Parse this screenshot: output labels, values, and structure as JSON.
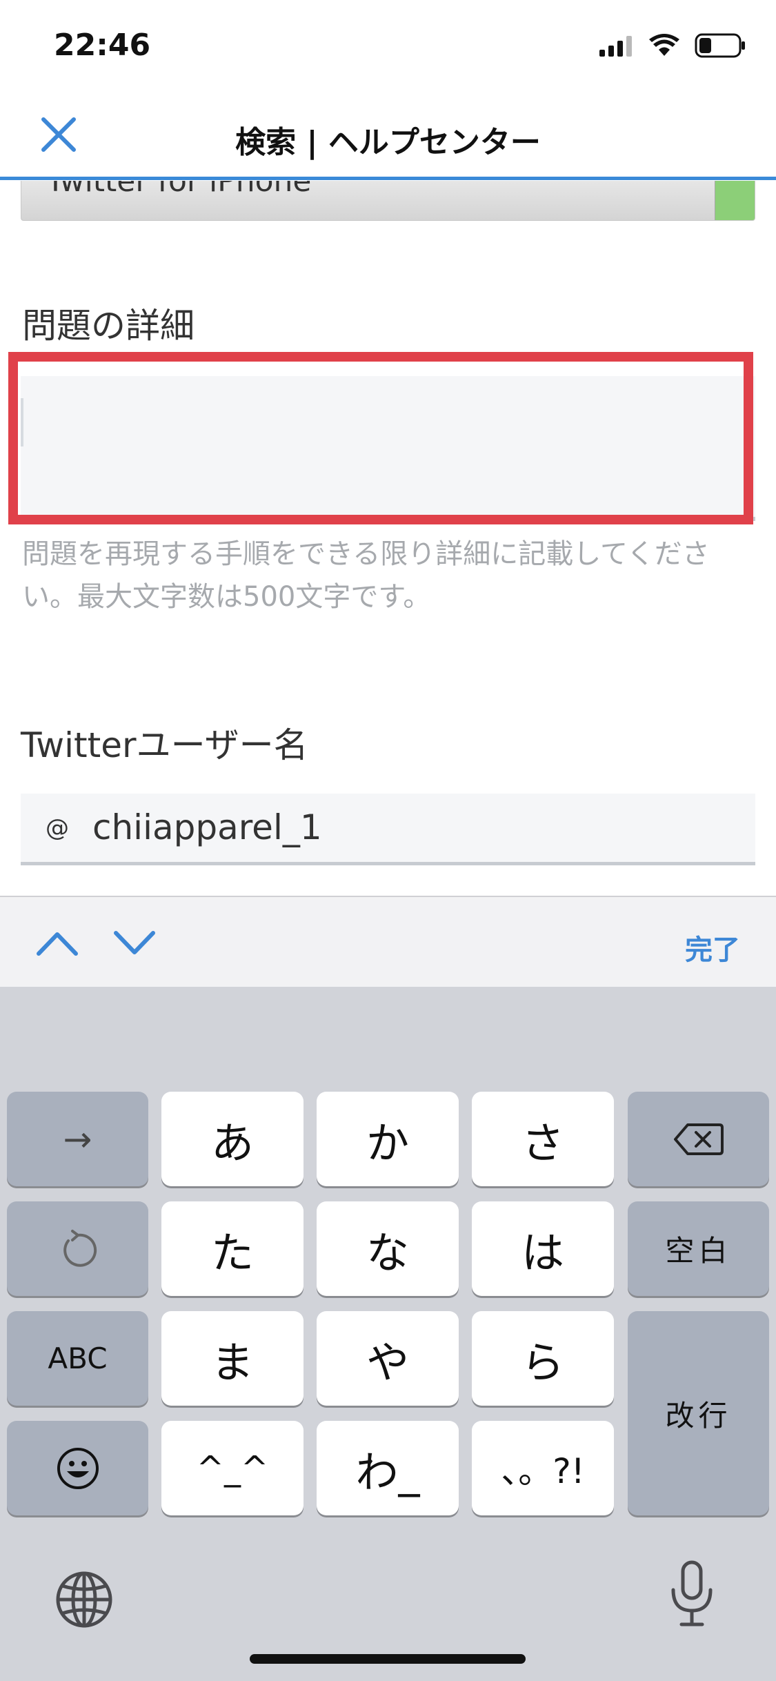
{
  "status_bar": {
    "time": "22:46",
    "icons": [
      "signal-icon",
      "wifi-icon",
      "battery-icon"
    ]
  },
  "nav": {
    "title": "検索 | ヘルプセンター",
    "close_icon": "close-icon"
  },
  "form": {
    "select_value": "Twitter for iPhone",
    "details_label": "問題の詳細",
    "details_value": "",
    "help_text": "問題を再現する手順をできる限り詳細に記載してください。最大文字数は500文字です。",
    "username_label": "Twitterユーザー名",
    "username_prefix": "@",
    "username_value": "chiiapparel_1"
  },
  "accessory": {
    "prev_icon": "chevron-up-icon",
    "next_icon": "chevron-down-icon",
    "done_label": "完了"
  },
  "keyboard": {
    "keys": {
      "next": "→",
      "a": "あ",
      "ka": "か",
      "sa": "さ",
      "ta": "た",
      "na": "な",
      "ha": "は",
      "ma": "ま",
      "ya": "や",
      "ra": "ら",
      "emoticon": "^_^",
      "wa": "わ_",
      "punct": "、。?!",
      "space": "空白",
      "return": "改行",
      "abc": "ABC"
    },
    "icons": [
      "arrow-right-icon",
      "delete-icon",
      "undo-icon",
      "emoji-icon",
      "globe-icon",
      "mic-icon"
    ]
  },
  "colors": {
    "accent": "#3d87d6",
    "highlight": "#e0414a",
    "keyboard_bg": "#d1d3d9"
  }
}
